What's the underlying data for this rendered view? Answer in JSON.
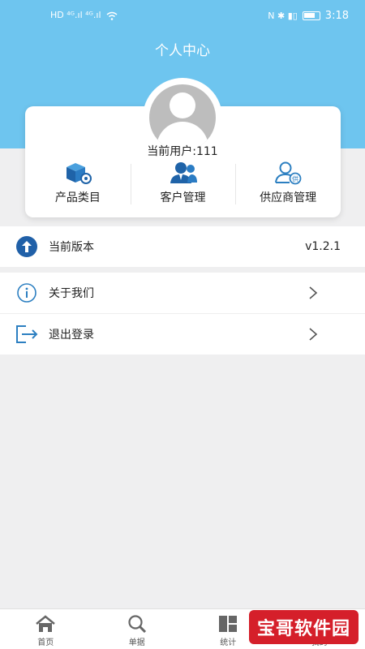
{
  "status_bar": {
    "left_signal": "HD ⁴ᴳ.ıl ⁴ᴳ.ıl",
    "right_icons": "N ✱ ▮▯",
    "time": "3:18"
  },
  "header": {
    "title": "个人中心",
    "background_color": "#6ec5ef"
  },
  "profile": {
    "username_text": "当前用户:111"
  },
  "menu": {
    "items": [
      {
        "label": "产品类目",
        "icon": "product-box-icon"
      },
      {
        "label": "客户管理",
        "icon": "customers-icon"
      },
      {
        "label": "供应商管理",
        "icon": "supplier-icon"
      }
    ]
  },
  "version_row": {
    "label": "当前版本",
    "value": "v1.2.1",
    "icon": "upload-arrow-icon"
  },
  "list": {
    "items": [
      {
        "label": "关于我们",
        "icon": "info-icon"
      },
      {
        "label": "退出登录",
        "icon": "logout-icon"
      }
    ]
  },
  "tabbar": {
    "tabs": [
      {
        "label": "首页",
        "icon": "home-icon"
      },
      {
        "label": "单据",
        "icon": "search-icon"
      },
      {
        "label": "统计",
        "icon": "stats-icon"
      },
      {
        "label": "我的",
        "icon": "profile-icon"
      }
    ]
  },
  "watermark": {
    "text": "宝哥软件园",
    "color": "#d51f2a"
  },
  "colors": {
    "accent_blue": "#2f6fbf",
    "icon_blue": "#2c7fc1"
  }
}
